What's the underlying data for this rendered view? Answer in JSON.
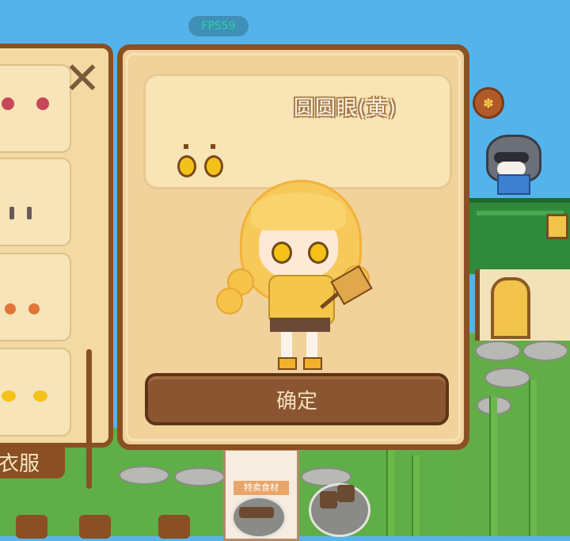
{
  "hud": {
    "fps_text": "FPS59"
  },
  "detail": {
    "item_title": "圆圆眼(黄)",
    "confirm_label": "确定"
  },
  "sidebar": {
    "close_symbol": "✕",
    "tab_label": "衣服",
    "items": [
      {
        "icon": "round-eyes-red-icon"
      },
      {
        "icon": "dot-eyes-icon"
      },
      {
        "icon": "small-eyes-orange-icon"
      },
      {
        "icon": "sleepy-eyes-yellow-icon"
      }
    ]
  },
  "world": {
    "stall_sign": "特卖食材",
    "npc_badge_symbol": "✽"
  },
  "colors": {
    "panel_bg": "#f0d29a",
    "panel_border": "#8a4f22",
    "button_bg": "#8a5530",
    "eye_yellow": "#f3c21a",
    "sky": "#55b3ec",
    "grass": "#5fae48"
  }
}
